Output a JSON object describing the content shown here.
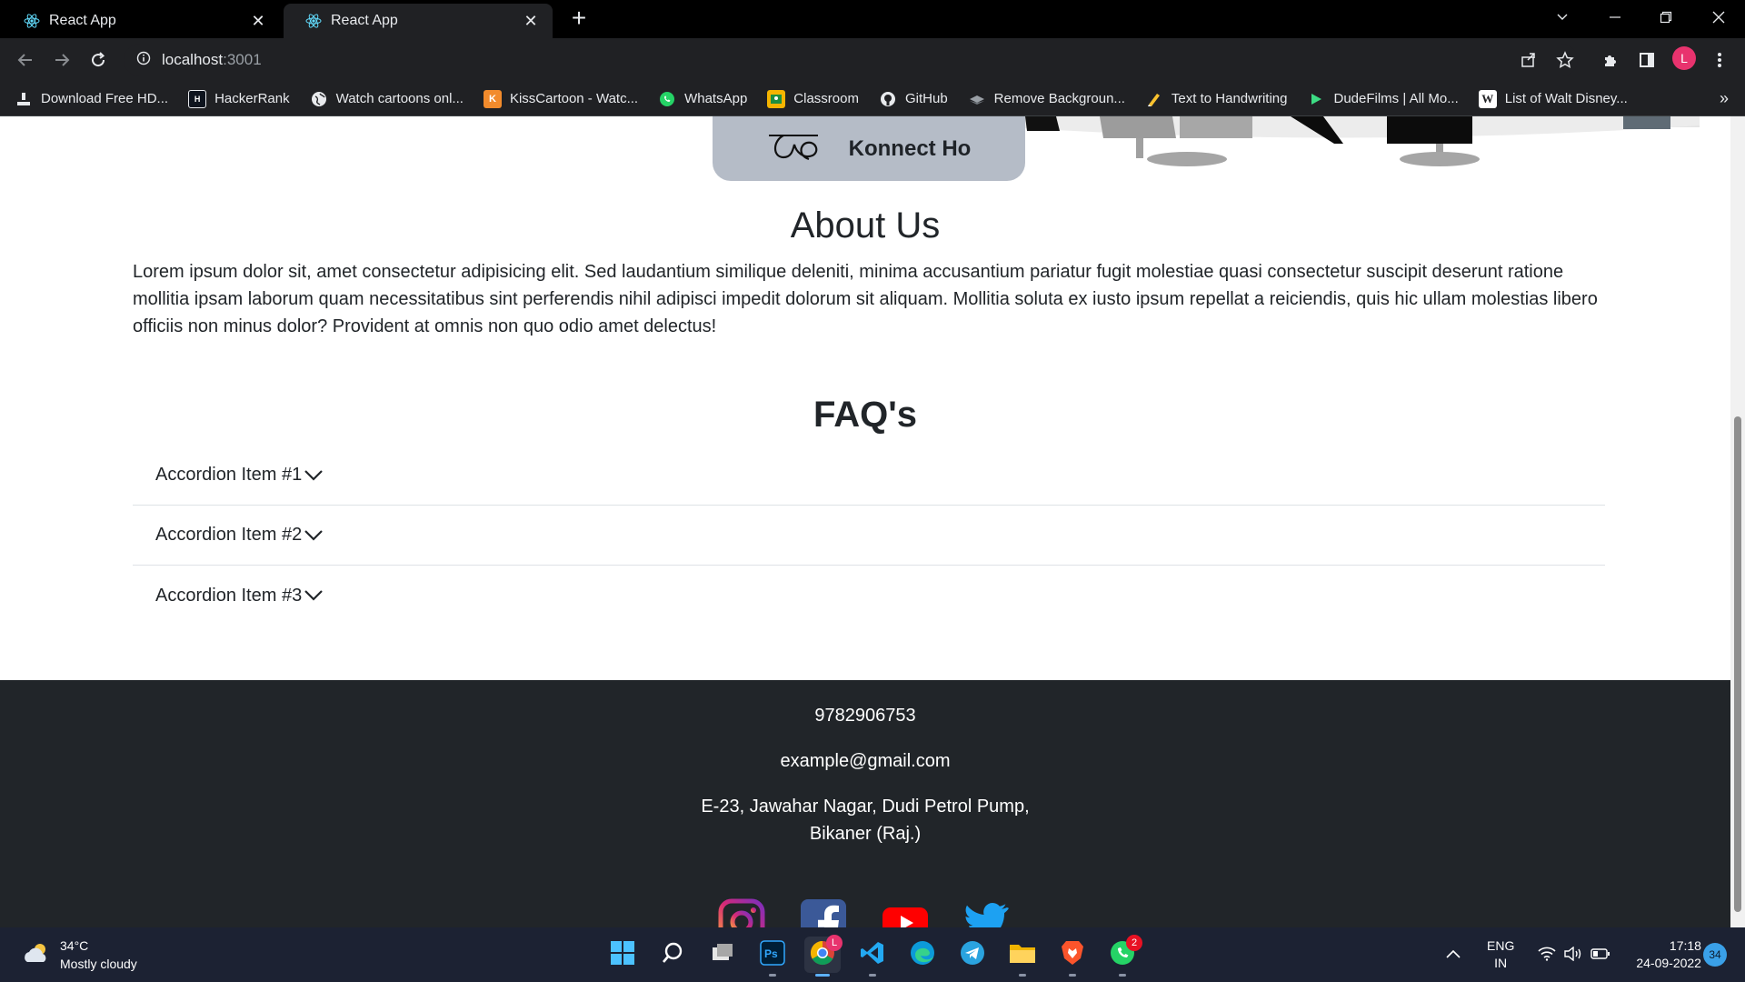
{
  "browser": {
    "tabs": [
      {
        "title": "React App",
        "active": false
      },
      {
        "title": "React App",
        "active": true
      }
    ],
    "url_host": "localhost",
    "url_port": ":3001",
    "bookmarks": [
      {
        "label": "Download Free HD...",
        "icon": "download-icon"
      },
      {
        "label": "HackerRank",
        "icon": "hackerrank-icon"
      },
      {
        "label": "Watch cartoons onl...",
        "icon": "globe-icon"
      },
      {
        "label": "KissCartoon - Watc...",
        "icon": "kisscartoon-icon"
      },
      {
        "label": "WhatsApp",
        "icon": "whatsapp-icon"
      },
      {
        "label": "Classroom",
        "icon": "classroom-icon"
      },
      {
        "label": "GitHub",
        "icon": "github-icon"
      },
      {
        "label": "Remove Backgroun...",
        "icon": "removebg-icon"
      },
      {
        "label": "Text to Handwriting",
        "icon": "handwriting-icon"
      },
      {
        "label": "DudeFilms | All Mo...",
        "icon": "play-icon"
      },
      {
        "label": "List of Walt Disney...",
        "icon": "wikipedia-icon"
      }
    ],
    "bookmarks_overflow": "»",
    "profile_initial": "L"
  },
  "page": {
    "brand_name": "Konnect Ho",
    "about": {
      "title": "About Us",
      "text": "Lorem ipsum dolor sit, amet consectetur adipisicing elit. Sed laudantium similique deleniti, minima accusantium pariatur fugit molestiae quasi consectetur suscipit deserunt ratione mollitia ipsam laborum quam necessitatibus sint perferendis nihil adipisci impedit dolorum sit aliquam. Mollitia soluta ex iusto ipsum repellat a reiciendis, quis hic ullam molestias libero officiis non minus dolor? Provident at omnis non quo odio amet delectus!"
    },
    "faq": {
      "title": "FAQ's",
      "items": [
        {
          "label": "Accordion Item #1"
        },
        {
          "label": "Accordion Item #2"
        },
        {
          "label": "Accordion Item #3"
        }
      ]
    },
    "footer": {
      "phone": "9782906753",
      "email": "example@gmail.com",
      "address_line1": "E-23, Jawahar Nagar, Dudi Petrol Pump,",
      "address_line2": "Bikaner (Raj.)",
      "socials": [
        "instagram-icon",
        "facebook-icon",
        "youtube-icon",
        "twitter-icon"
      ]
    }
  },
  "taskbar": {
    "weather_temp": "34°C",
    "weather_desc": "Mostly cloudy",
    "chrome_badge": "L",
    "whatsapp_badge": "2",
    "lang_line1": "ENG",
    "lang_line2": "IN",
    "time": "17:18",
    "date": "24-09-2022",
    "notifications": "34"
  },
  "colors": {
    "footer_bg": "#212529",
    "brand_card": "#b5bcc7",
    "chrome_dark": "#202124",
    "taskbar": "#1c2233"
  }
}
